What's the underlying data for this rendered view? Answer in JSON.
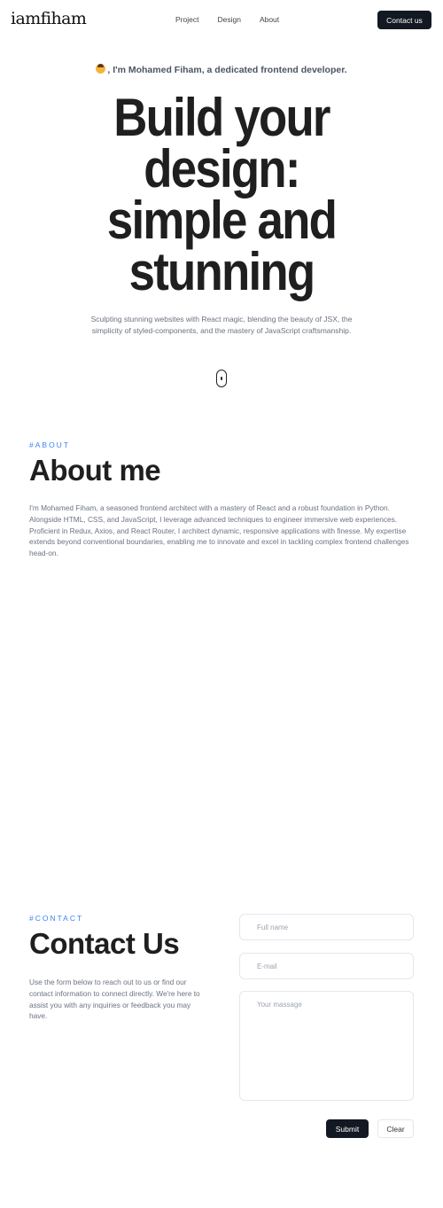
{
  "header": {
    "logo": "iamfiham",
    "nav": [
      "Project",
      "Design",
      "About"
    ],
    "contact_button": "Contact us"
  },
  "hero": {
    "intro": "I'm Mohamed Fiham, a dedicated frontend developer.",
    "intro_icon": "developer-emoji-icon",
    "title_lines": [
      "Build your",
      "design:",
      "simple and",
      "stunning"
    ],
    "subtitle": "Sculpting stunning websites with React magic, blending the beauty of JSX, the simplicity of styled-components, and the mastery of JavaScript craftsmanship."
  },
  "about": {
    "tag": "#ABOUT",
    "title": "About me",
    "body": "I'm Mohamed Fiham, a seasoned frontend architect with a mastery of React and a robust foundation in Python. Alongside HTML, CSS, and JavaScript, I leverage advanced techniques to engineer immersive web experiences. Proficient in Redux, Axios, and React Router, I architect dynamic, responsive applications with finesse. My expertise extends beyond conventional boundaries, enabling me to innovate and excel in tackling complex frontend challenges head-on."
  },
  "contact": {
    "tag": "#CONTACT",
    "title": "Contact Us",
    "body": "Use the form below to reach out to us or find our contact information to connect directly. We're here to assist you with any inquiries or feedback you may have.",
    "form": {
      "fullname_placeholder": "Full name",
      "email_placeholder": "E-mail",
      "message_placeholder": "Your massage",
      "submit_label": "Submit",
      "clear_label": "Clear"
    }
  },
  "colors": {
    "accent": "#3b82f6",
    "button_dark": "#131923",
    "text_dark": "#1f1f1f",
    "text_muted": "#6b7280"
  }
}
